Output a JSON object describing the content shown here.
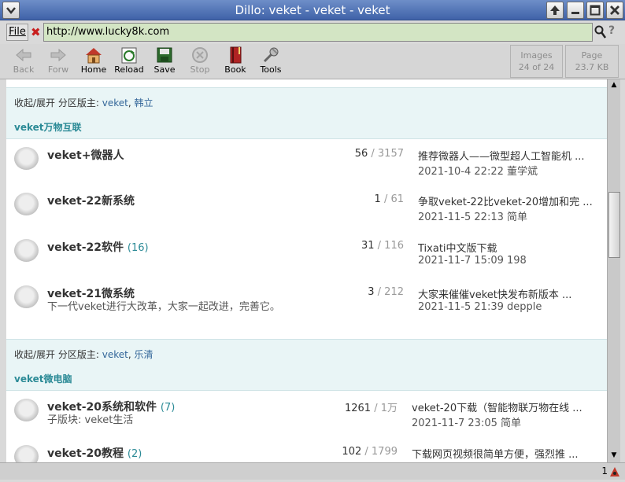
{
  "window": {
    "title": "Dillo: veket - veket - veket"
  },
  "location": {
    "file_label": "File",
    "url": "http://www.lucky8k.com"
  },
  "toolbar": {
    "back": "Back",
    "forward": "Forw",
    "home": "Home",
    "reload": "Reload",
    "save": "Save",
    "stop": "Stop",
    "book": "Book",
    "tools": "Tools",
    "images_label": "Images",
    "images_value": "24 of 24",
    "page_label": "Page",
    "page_value": "23.7 KB"
  },
  "sections": [
    {
      "mods_label": "收起/展开 分区版主:",
      "mods": [
        "veket",
        "韩立"
      ],
      "title": "veket万物互联",
      "forums": [
        {
          "name": "veket+微器人",
          "count": "",
          "desc": "",
          "posts": "56",
          "total": "/ 3157",
          "last": "推荐微器人——微型超人工智能机 ...",
          "last_meta": "2021-10-4 22:22 董学斌"
        },
        {
          "name": "veket-22新系统",
          "count": "",
          "desc": "",
          "posts": "1",
          "total": "/ 61",
          "last": "争取veket-22比veket-20增加和完 ...",
          "last_meta": "2021-11-5 22:13 简单"
        },
        {
          "name": "veket-22软件",
          "count": "(16)",
          "desc": "",
          "posts": "31",
          "total": "/ 116",
          "last": "Tixati中文版下载",
          "last_meta": "2021-11-7 15:09 198"
        },
        {
          "name": "veket-21微系统",
          "count": "",
          "desc": "下一代veket进行大改革，大家一起改进，完善它。",
          "posts": "3",
          "total": "/ 212",
          "last": "大家来催催veket快发布新版本 ...",
          "last_meta": "2021-11-5 21:39 depple"
        }
      ]
    },
    {
      "mods_label": "收起/展开 分区版主:",
      "mods": [
        "veket",
        "乐清"
      ],
      "title": "veket微电脑",
      "forums": [
        {
          "name": "veket-20系统和软件",
          "count": "(7)",
          "desc": "子版块: veket生活",
          "posts": "1261",
          "total": "/ 1万",
          "last": "veket-20下载（智能物联万物在线 ...",
          "last_meta": "2021-11-7 23:05 简单"
        },
        {
          "name": "veket-20教程",
          "count": "(2)",
          "desc": "",
          "posts": "102",
          "total": "/ 1799",
          "last": "下载网页视频很简单方便，强烈推 ...",
          "last_meta": ""
        }
      ]
    }
  ],
  "status": {
    "message": "1"
  },
  "colors": {
    "titlebar": "#3f62a8",
    "url_bg": "#d3e5c4",
    "section_bg": "#e9f5f6",
    "accent": "#2b8a96"
  }
}
